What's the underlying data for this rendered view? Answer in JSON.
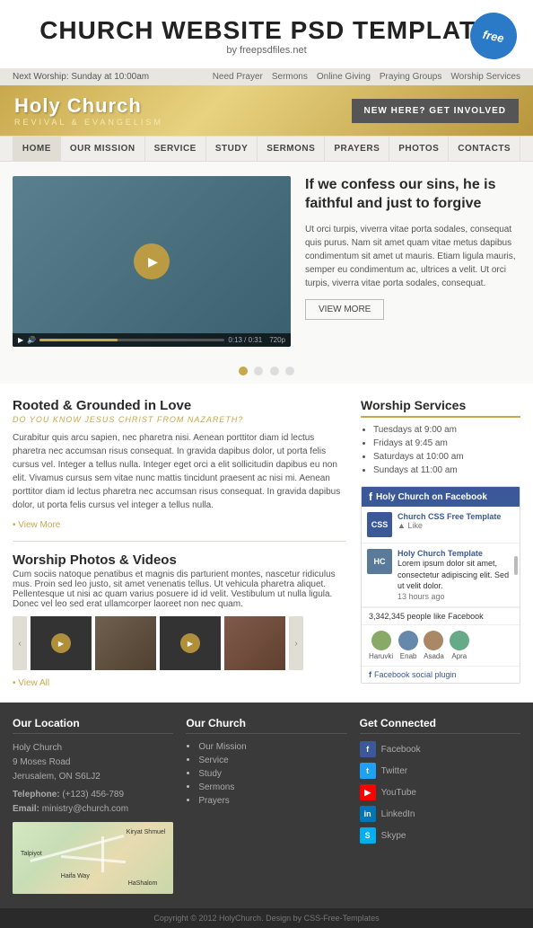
{
  "header": {
    "title": "CHURCH WEBSITE PSD TEMPLATE",
    "subtitle": "by freepsdfiles.net",
    "badge": "free"
  },
  "topbar": {
    "left": "Next Worship: Sunday at 10:00am",
    "links": [
      "Need Prayer",
      "Sermons",
      "Online Giving",
      "Praying Groups",
      "Worship Services"
    ]
  },
  "logobar": {
    "name": "Holy Church",
    "tagline": "REVIVAL & EVANGELISM",
    "cta": "NEW HERE? GET INVOLVED"
  },
  "nav": {
    "items": [
      "HOME",
      "OUR MISSION",
      "SERVICE",
      "STUDY",
      "SERMONS",
      "PRAYERS",
      "PHOTOS",
      "CONTACTS"
    ]
  },
  "hero": {
    "heading": "If we confess our sins, he is faithful and just to forgive",
    "body": "Ut orci turpis, viverra vitae porta sodales, consequat quis purus. Nam sit amet quam vitae metus dapibus condimentum sit amet ut mauris. Etiam ligula mauris, semper eu condimentum ac, ultrices a velit. Ut orci turpis, viverra vitae porta sodales, consequat.",
    "view_more": "VIEW MORE",
    "video_time": "0:13 / 0:31",
    "video_quality": "720p"
  },
  "section1": {
    "title": "Rooted & Grounded in Love",
    "subtitle": "Do You Know Jesus Christ From Nazareth?",
    "text1": "Curabitur quis arcu sapien, nec pharetra nisi. Aenean porttitor diam id lectus pharetra nec accumsan risus consequat. In gravida dapibus dolor, ut porta felis cursus vel. Integer a tellus nulla. Integer eget orci a elit sollicitudin dapibus eu non elit. Vivamus cursus sem vitae nunc mattis tincidunt praesent ac nisi mi. Aenean porttitor diam id lectus pharetra nec accumsan risus consequat. In gravida dapibus dolor, ut porta felis cursus vel integer a tellus nulla.",
    "view_more": "• View More"
  },
  "section2": {
    "title": "Worship Photos & Videos",
    "text": "Cum sociis natoque penatibus et magnis dis parturient montes, nascetur ridiculus mus. Proin sed leo justo, sit amet venenatis tellus. Ut vehicula pharetra aliquet. Pellentesque ut nisi ac quam varius posuere id id velit. Vestibulum ut nulla ligula. Donec vel leo sed erat ullamcorper laoreet non nec quam.",
    "view_all": "• View All"
  },
  "worship": {
    "title": "Worship Services",
    "times": [
      "Tuesdays at 9:00 am",
      "Fridays at 9:45 am",
      "Saturdays at 10:00 am",
      "Sundays at 11:00 am"
    ]
  },
  "facebook": {
    "title": "Holy Church on Facebook",
    "post1_name": "Church CSS Free Template",
    "post1_likes": "▲ Like",
    "post2_name": "Holy Church Template",
    "post2_text": "Lorem ipsum dolor sit amet, consectetur adipiscing elit. Sed ut velit dolor.",
    "post2_time": "13 hours ago",
    "followers": "3,342,345 people like Facebook",
    "avatars": [
      "Haruvki",
      "Enab",
      "Asada",
      "Apra"
    ],
    "plugin": "Facebook social plugin"
  },
  "footer": {
    "location": {
      "title": "Our Location",
      "name": "Holy Church",
      "address1": "9 Moses Road",
      "address2": "Jerusalem, ON S6LJ2",
      "phone_label": "Telephone:",
      "phone": "(+123) 456-789",
      "email_label": "Email:",
      "email": "ministry@church.com"
    },
    "church": {
      "title": "Our Church",
      "links": [
        "Our Mission",
        "Service",
        "Study",
        "Sermons",
        "Prayers"
      ]
    },
    "social": {
      "title": "Get Connected",
      "networks": [
        "Facebook",
        "Twitter",
        "YouTube",
        "LinkedIn",
        "Skype"
      ]
    }
  },
  "copyright": "Copyright © 2012 HolyChurch. Design by CSS-Free-Templates",
  "colors": {
    "gold": "#c9a84c",
    "navy": "#3b5998",
    "dark": "#3a3a3a"
  }
}
